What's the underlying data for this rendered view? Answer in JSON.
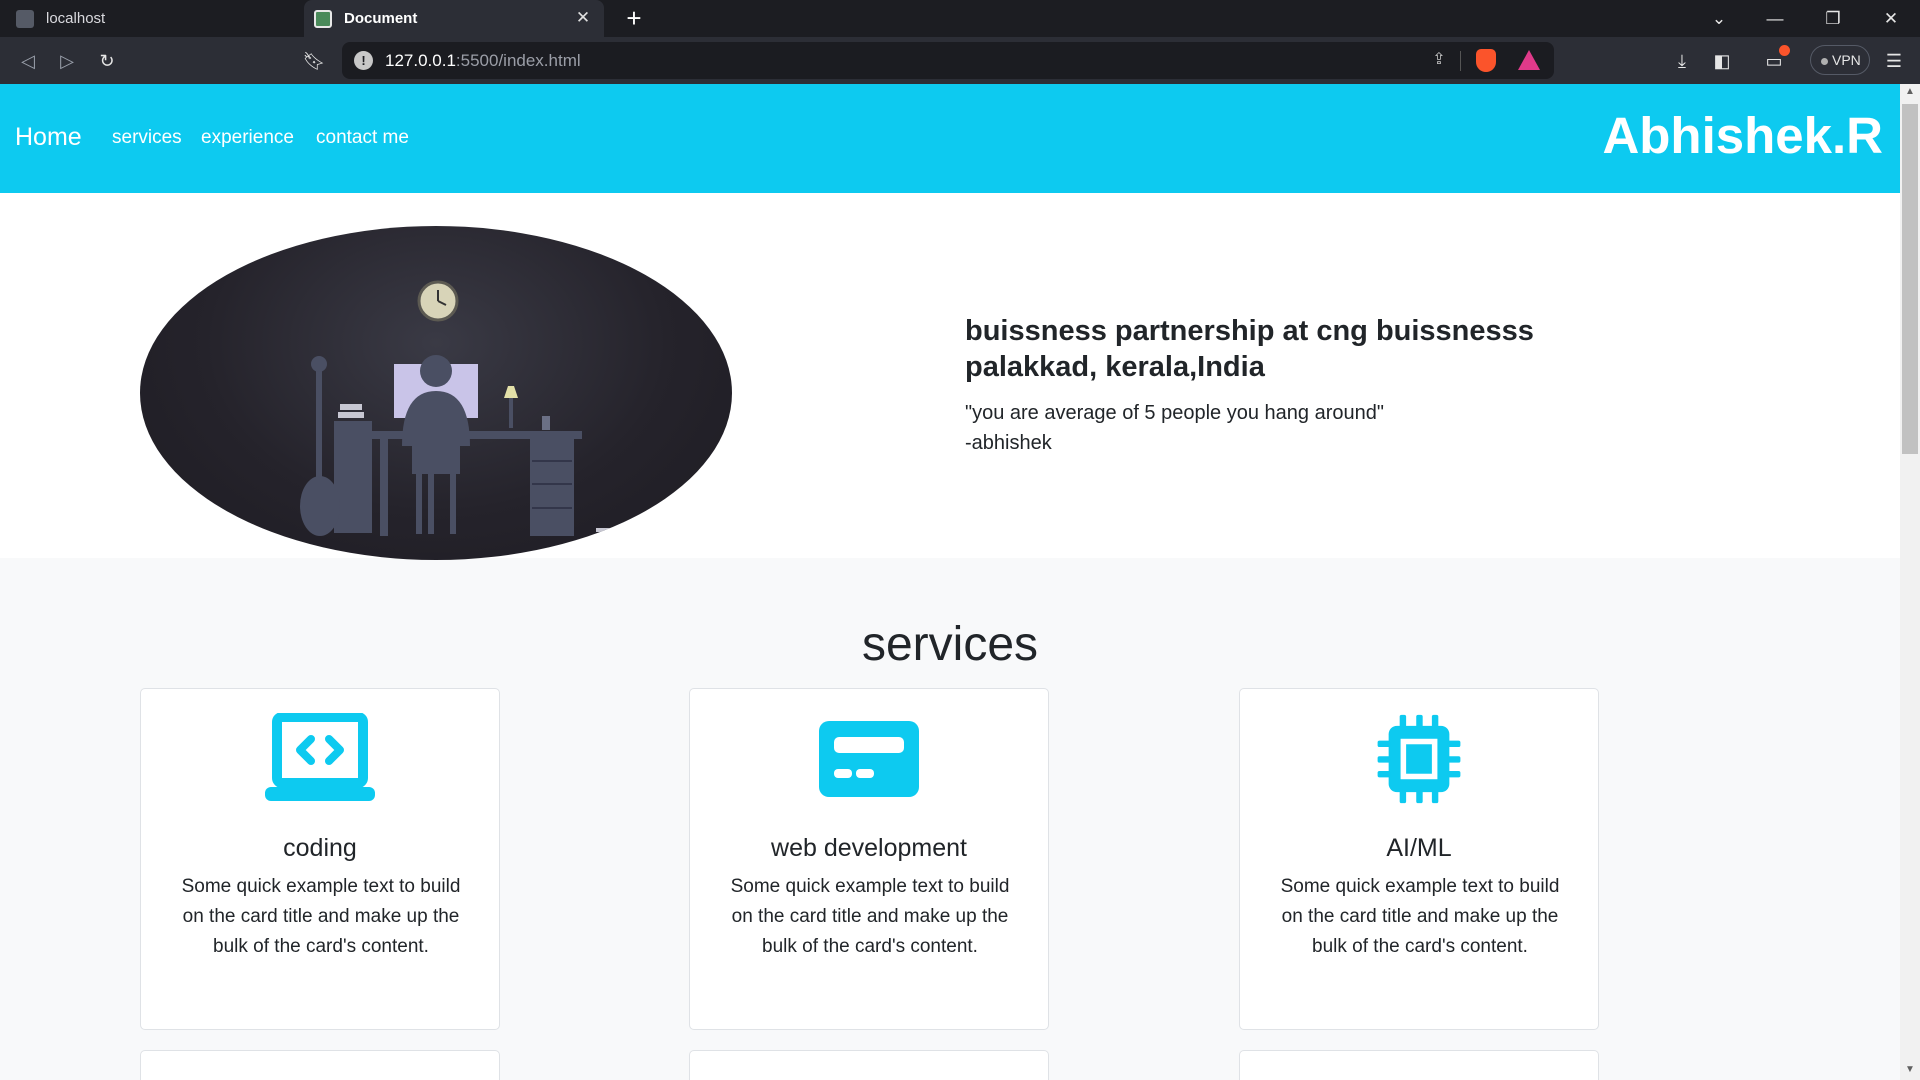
{
  "browser": {
    "tabs": [
      {
        "title": "localhost"
      },
      {
        "title": "Document"
      }
    ],
    "url": {
      "host": "127.0.0.1",
      "path": ":5500/index.html"
    },
    "vpn_label": "VPN"
  },
  "nav": {
    "home": "Home",
    "links": [
      "services",
      "experience",
      "contact me"
    ],
    "brand": "Abhishek.R",
    "color": "#0dcaf0"
  },
  "hero": {
    "title_line1": "buissness partnership at cng buissnesss",
    "title_line2": "palakkad, kerala,India",
    "quote": "\"you are average of 5 people you hang around\"",
    "author": "-abhishek"
  },
  "services": {
    "heading": "services",
    "cards": [
      {
        "icon": "laptop-code-icon",
        "title": "coding",
        "text": "Some quick example text to build on the card title and make up the bulk of the card's content."
      },
      {
        "icon": "credit-card-icon",
        "title": "web development",
        "text": "Some quick example text to build on the card title and make up the bulk of the card's content."
      },
      {
        "icon": "cpu-chip-icon",
        "title": "AI/ML",
        "text": "Some quick example text to build on the card title and make up the bulk of the card's content."
      }
    ]
  }
}
